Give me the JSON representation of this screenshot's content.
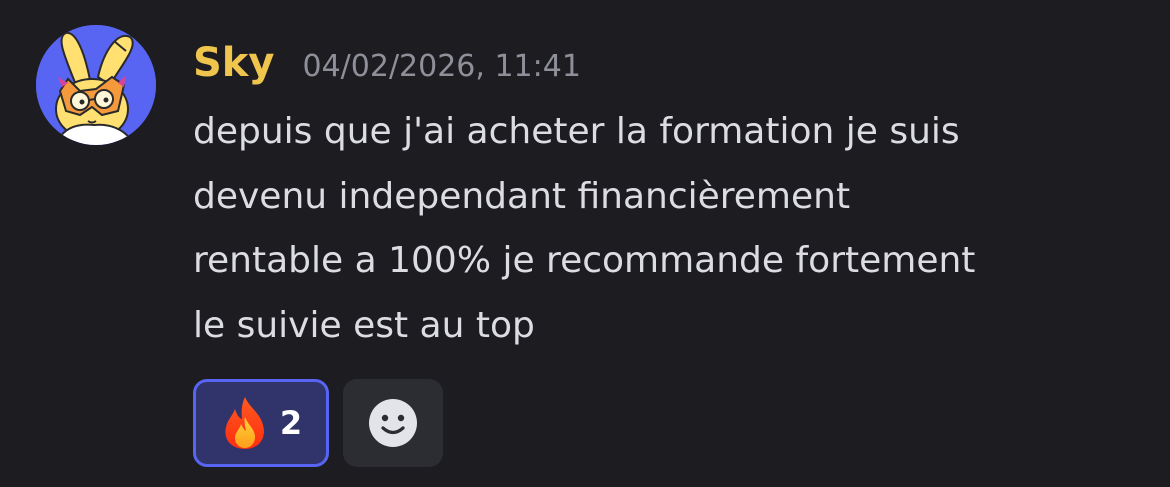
{
  "message": {
    "author": "Sky",
    "timestamp": "04/02/2026, 11:41",
    "content_lines": [
      "depuis que j'ai acheter la formation je suis",
      "devenu independant financièrement",
      "rentable a 100% je recommande fortement",
      "le suivie est au top"
    ],
    "author_color": "#f0c54d"
  },
  "reactions": [
    {
      "emoji": "fire-icon",
      "count": "2",
      "active": true
    },
    {
      "emoji": "add-reaction-icon"
    }
  ],
  "colors": {
    "background": "#1c1c21",
    "text": "#dcdde3",
    "timestamp": "#8e8f99",
    "reaction_active_bg": "#31346a",
    "reaction_active_border": "#5865f2"
  }
}
